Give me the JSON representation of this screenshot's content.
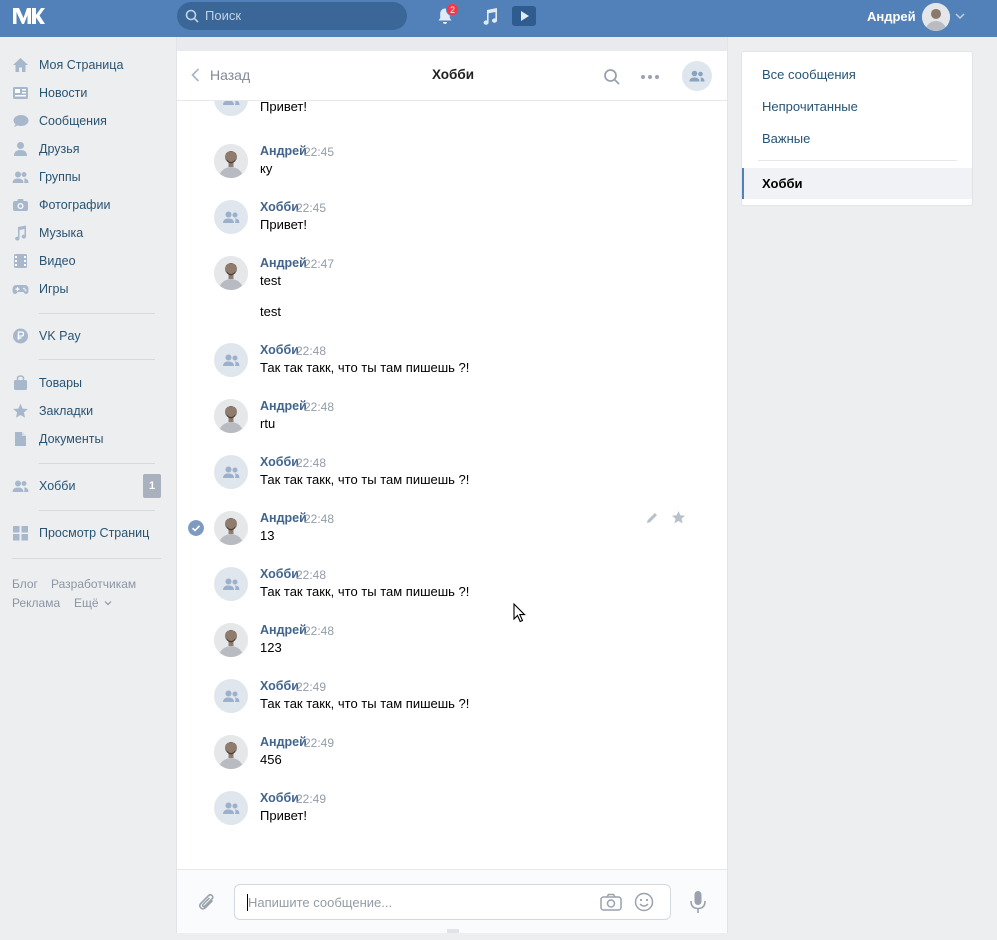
{
  "header": {
    "search_placeholder": "Поиск",
    "notifications_count": "2",
    "user_name": "Андрей"
  },
  "sidebar": {
    "items": [
      {
        "label": "Моя Страница",
        "icon": "home-icon"
      },
      {
        "label": "Новости",
        "icon": "news-icon"
      },
      {
        "label": "Сообщения",
        "icon": "messages-icon"
      },
      {
        "label": "Друзья",
        "icon": "friend-icon"
      },
      {
        "label": "Группы",
        "icon": "groups-icon"
      },
      {
        "label": "Фотографии",
        "icon": "camera-icon"
      },
      {
        "label": "Музыка",
        "icon": "music-icon"
      },
      {
        "label": "Видео",
        "icon": "film-icon"
      },
      {
        "label": "Игры",
        "icon": "gamepad-icon"
      },
      {
        "label": "VK Pay",
        "icon": "ruble-icon"
      },
      {
        "label": "Товары",
        "icon": "bag-icon"
      },
      {
        "label": "Закладки",
        "icon": "star-icon"
      },
      {
        "label": "Документы",
        "icon": "document-icon"
      },
      {
        "label": "Хобби",
        "icon": "groups-icon",
        "count": "1"
      },
      {
        "label": "Просмотр Страниц",
        "icon": "apps-icon"
      }
    ],
    "footer": {
      "blog": "Блог",
      "developers": "Разработчикам",
      "ads": "Реклама",
      "more": "Ещё"
    }
  },
  "chat": {
    "back_label": "Назад",
    "title": "Хобби",
    "partial_first_message": "Привет!",
    "messages": [
      {
        "author": "Андрей",
        "time": "22:45",
        "text": "ку",
        "type": "user"
      },
      {
        "author": "Хобби",
        "time": "22:45",
        "text": "Привет!",
        "type": "group"
      },
      {
        "author": "Андрей",
        "time": "22:47",
        "text": "test",
        "text2": "test",
        "type": "user"
      },
      {
        "author": "Хобби",
        "time": "22:48",
        "text": "Так так такк, что ты там пишешь ?!",
        "type": "group"
      },
      {
        "author": "Андрей",
        "time": "22:48",
        "text": "rtu",
        "type": "user"
      },
      {
        "author": "Хобби",
        "time": "22:48",
        "text": "Так так такк, что ты там пишешь ?!",
        "type": "group"
      },
      {
        "author": "Андрей",
        "time": "22:48",
        "text": "13",
        "type": "user",
        "selected": true
      },
      {
        "author": "Хобби",
        "time": "22:48",
        "text": "Так так такк, что ты там пишешь ?!",
        "type": "group"
      },
      {
        "author": "Андрей",
        "time": "22:48",
        "text": "123",
        "type": "user"
      },
      {
        "author": "Хобби",
        "time": "22:49",
        "text": "Так так такк, что ты там пишешь ?!",
        "type": "group"
      },
      {
        "author": "Андрей",
        "time": "22:49",
        "text": "456",
        "type": "user"
      },
      {
        "author": "Хобби",
        "time": "22:49",
        "text": "Привет!",
        "type": "group"
      }
    ],
    "composer_placeholder": "Напишите сообщение..."
  },
  "rightnav": {
    "all": "Все сообщения",
    "unread": "Непрочитанные",
    "important": "Важные",
    "active": "Хобби"
  },
  "colors": {
    "header": "#5181b8",
    "link": "#285473",
    "author": "#42648b",
    "badge": "#ff3347"
  }
}
